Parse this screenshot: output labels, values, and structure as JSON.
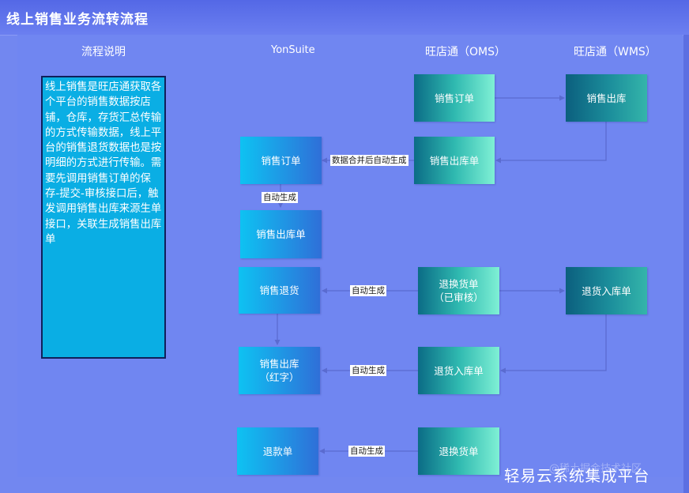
{
  "title": "线上销售业务流转流程",
  "columns": {
    "desc": "流程说明",
    "ys": "YonSuite",
    "oms": "旺店通（OMS）",
    "wms": "旺店通（WMS）"
  },
  "description": "线上销售是旺店通获取各个平台的销售数据按店铺，仓库，存货汇总传输的方式传输数据，线上平台的销售退货数据也是按明细的方式进行传输。需要先调用销售订单的保存-提交-审核接口后，触发调用销售出库来源生单接口，关联生成销售出库单",
  "boxes": {
    "oms_order": "销售订单",
    "wms_out": "销售出库",
    "ys_order": "销售订单",
    "oms_outbill": "销售出库单",
    "ys_outbill": "销售出库单",
    "ys_return": "销售退货",
    "oms_exchange_1": "退换货单",
    "oms_exchange_2": "（已审核）",
    "wms_return_in": "退货入库单",
    "ys_red_1": "销售出库",
    "ys_red_2": "（红字）",
    "oms_return_in": "退货入库单",
    "ys_refund": "退款单",
    "oms_exchange_b": "退换货单"
  },
  "labels": {
    "merge": "数据合并后自动生成",
    "auto1": "自动生成",
    "auto2": "自动生成",
    "auto3": "自动生成",
    "auto4": "自动生成"
  },
  "watermark": "轻易云系统集成平台",
  "watermark_faint": "@稀土掘金技术社区",
  "colors": {
    "background": "#7287f0",
    "yonsuite_box": "#0ec2f2",
    "oms_box": "#2fb9b0",
    "connector": "#5a6bd0"
  }
}
